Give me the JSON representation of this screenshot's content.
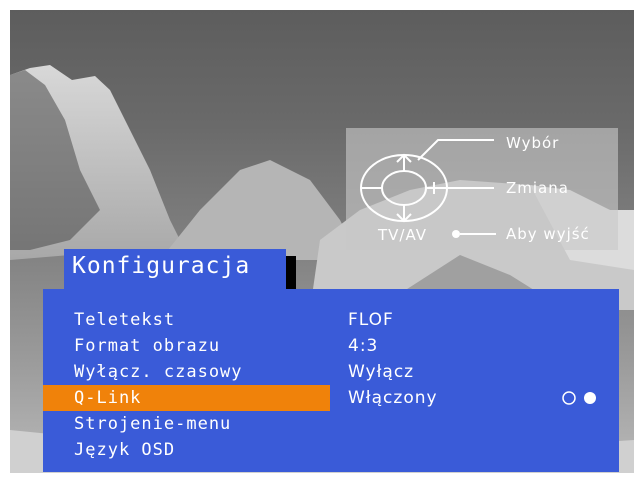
{
  "osd": {
    "title": "Konfiguracja",
    "items": [
      {
        "label": "Teletekst",
        "value": "FLOF"
      },
      {
        "label": "Format obrazu",
        "value": "4:3"
      },
      {
        "label": "Wyłącz. czasowy",
        "value": "Wyłącz"
      },
      {
        "label": "Q-Link",
        "value": "Włączony"
      },
      {
        "label": "Strojenie-menu",
        "value": ""
      },
      {
        "label": "Język OSD",
        "value": ""
      }
    ],
    "selected_index": 3
  },
  "help": {
    "select": "Wybór",
    "change": "Zmiana",
    "source": "TV/AV",
    "exit": "Aby wyjść"
  },
  "colors": {
    "panel": "#3a5bd8",
    "highlight": "#f0820a",
    "text": "#ffffff"
  },
  "icons": {
    "dpad": "remote-dpad-icon",
    "toggle": "toggle-dots-icon"
  }
}
